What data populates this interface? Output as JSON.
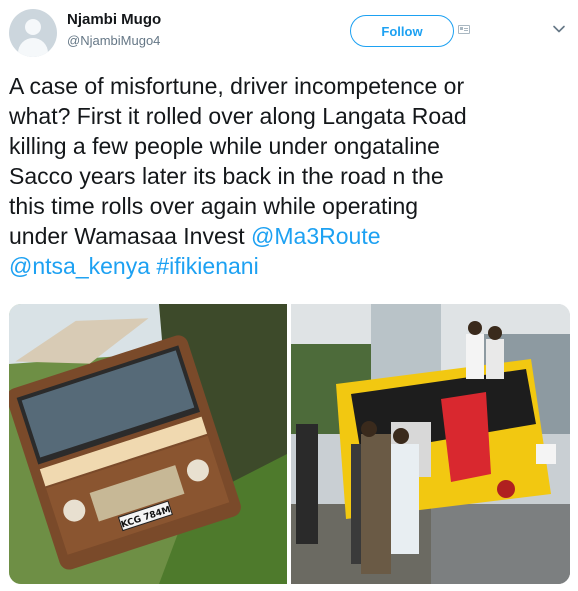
{
  "author": {
    "name": "Njambi Mugo",
    "handle": "@NjambiMugo4"
  },
  "actions": {
    "follow_label": "Follow"
  },
  "icons": {
    "avatar": "default-avatar-icon",
    "card": "media-card-icon",
    "menu": "chevron-down-icon"
  },
  "tweet": {
    "text_line1": "A case of misfortune, driver incompetence or",
    "text_line2": "what? First it rolled over along Langata Road",
    "text_line3": "killing a few people while under ongataline",
    "text_line4": "Sacco years later its back in the road n the",
    "text_line5": "this time rolls over again while operating",
    "text_line6": "under Wamasaa Invest",
    "mention1": "@Ma3Route",
    "mention2": "@ntsa_kenya",
    "hashtag": "#ifikienani"
  },
  "photos": {
    "left_plate": "KCG 784M"
  },
  "colors": {
    "accent": "#1da1f2",
    "text": "#14171a",
    "muted": "#657786"
  }
}
